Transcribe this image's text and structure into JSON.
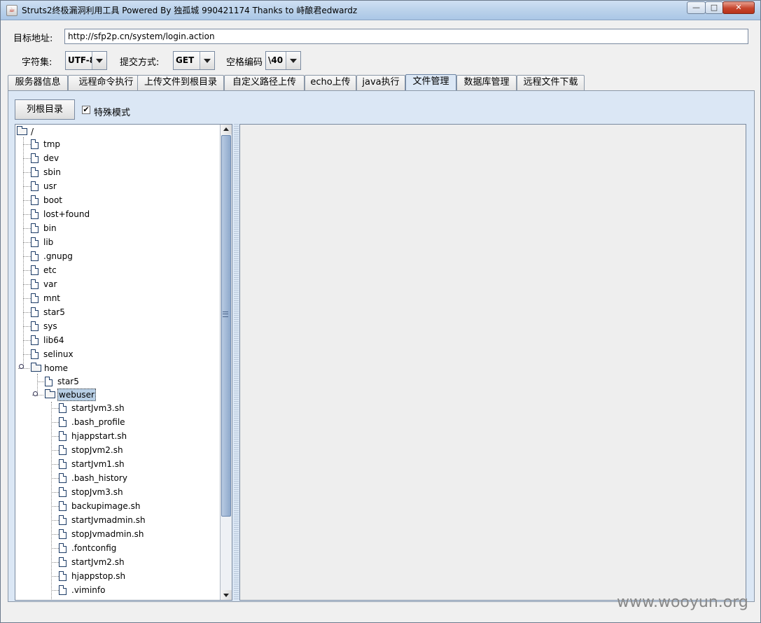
{
  "window": {
    "title": "Struts2终极漏洞利用工具   Powered By 独孤城 990421174 Thanks to 峙酿君edwardz",
    "minimize_symbol": "—",
    "maximize_symbol": "□",
    "close_symbol": "✕"
  },
  "form": {
    "target_label": "目标地址:",
    "target_value": "http://sfp2p.cn/system/login.action",
    "charset_label": "字符集:",
    "charset_value": "UTF-8",
    "method_label": "提交方式:",
    "method_value": "GET",
    "space_label": "空格编码",
    "space_value": "\\40"
  },
  "tabs": [
    {
      "label": "服务器信息"
    },
    {
      "label": "远程命令执行"
    },
    {
      "label": "上传文件到根目录"
    },
    {
      "label": "自定义路径上传"
    },
    {
      "label": "echo上传"
    },
    {
      "label": "java执行"
    },
    {
      "label": "文件管理",
      "active": true
    },
    {
      "label": "数据库管理"
    },
    {
      "label": "远程文件下载"
    }
  ],
  "file_manager": {
    "list_root_button": "列根目录",
    "special_mode_label": "特殊模式",
    "special_mode_checked": true,
    "check_glyph": "✔",
    "tree": {
      "root": "/",
      "root_children": [
        "tmp",
        "dev",
        "sbin",
        "usr",
        "boot",
        "lost+found",
        "bin",
        "lib",
        ".gnupg",
        "etc",
        "var",
        "mnt",
        "star5",
        "sys",
        "lib64",
        "selinux"
      ],
      "home": "home",
      "home_children": [
        "star5"
      ],
      "webuser": "webuser",
      "webuser_children": [
        "startJvm3.sh",
        ".bash_profile",
        "hjappstart.sh",
        "stopJvm2.sh",
        "startJvm1.sh",
        ".bash_history",
        "stopJvm3.sh",
        "backupimage.sh",
        "startJvmadmin.sh",
        "stopJvmadmin.sh",
        ".fontconfig",
        "startJvm2.sh",
        "hjappstop.sh",
        ".viminfo"
      ]
    }
  },
  "watermark": "www.wooyun.org"
}
